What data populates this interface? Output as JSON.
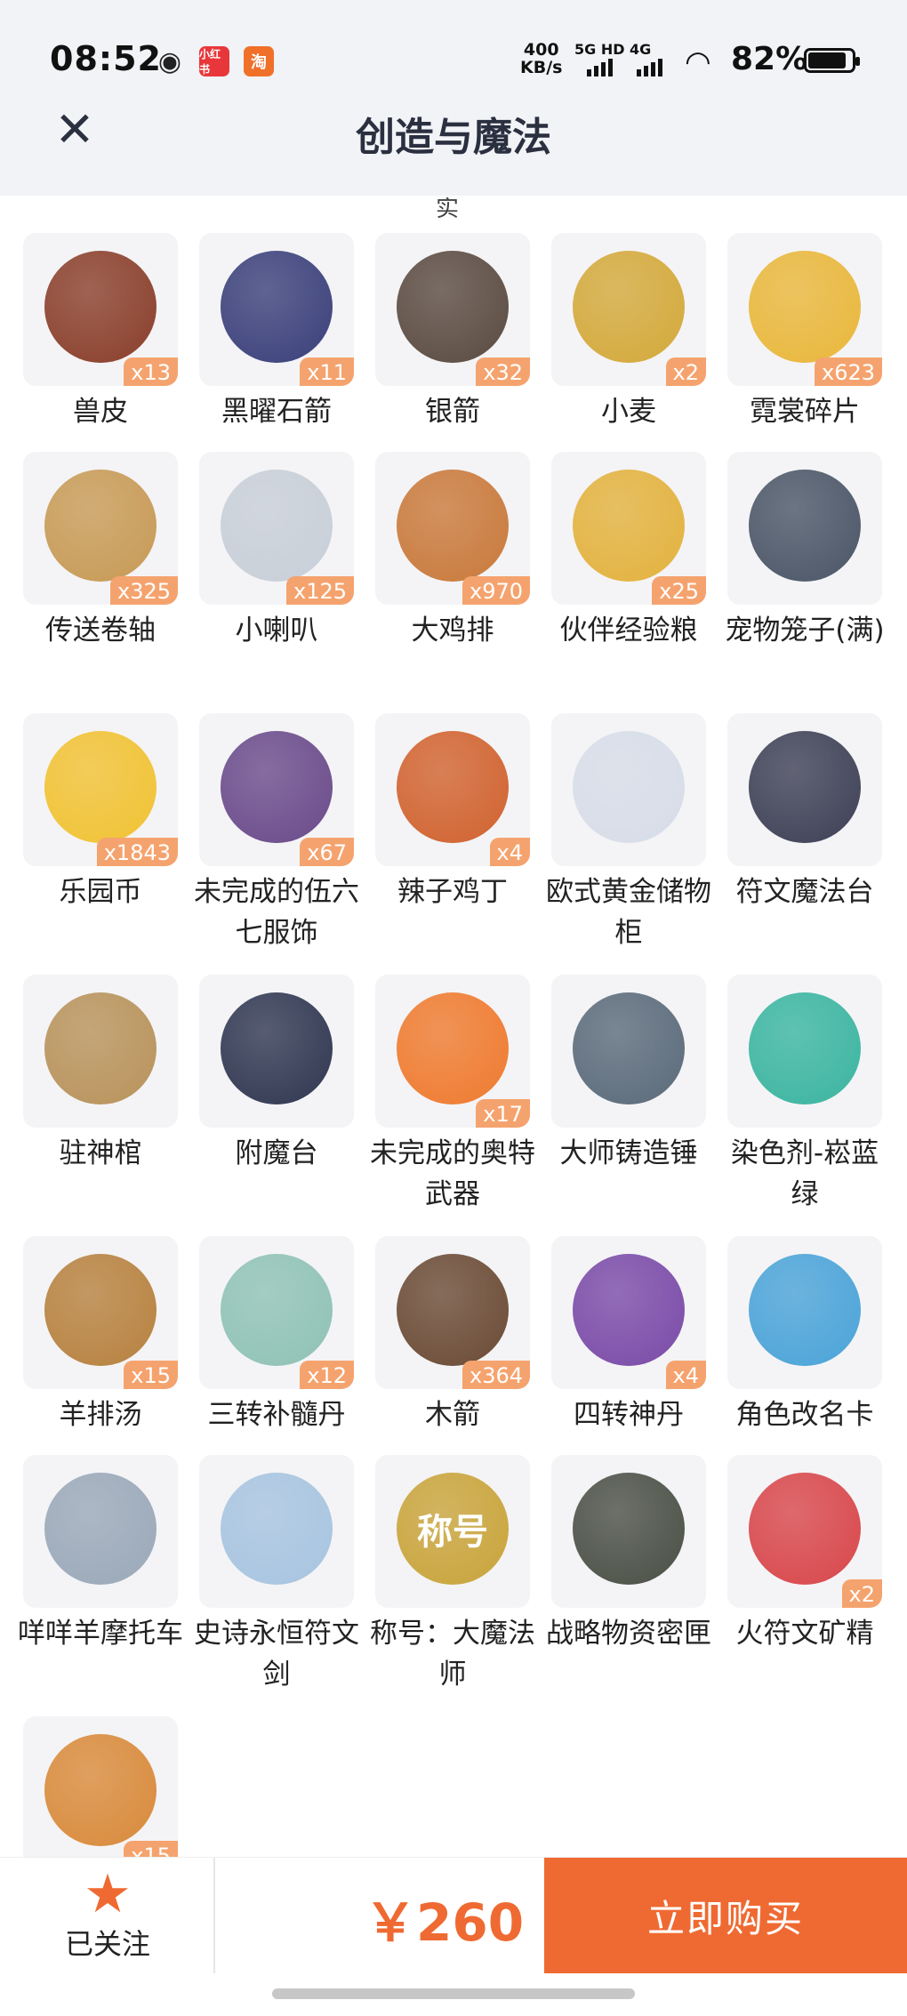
{
  "status_bar": {
    "time": "08:52",
    "net_speed_value": "400",
    "net_speed_unit": "KB/s",
    "net_label_1": "5G HD",
    "net_label_2": "4G",
    "battery": "82%",
    "app_icon_1": "小红书",
    "app_icon_2": "淘"
  },
  "header": {
    "title": "创造与魔法",
    "close_icon": "close-icon"
  },
  "grid_clip_text": "实",
  "items": [
    {
      "name": "兽皮",
      "count": "x13",
      "icon": "hide-icon",
      "color": "#8a3e2a"
    },
    {
      "name": "黑曜石箭",
      "count": "x11",
      "icon": "arrow-icon",
      "color": "#3a3f7a"
    },
    {
      "name": "银箭",
      "count": "x32",
      "icon": "arrow-icon",
      "color": "#5a4a40"
    },
    {
      "name": "小麦",
      "count": "x2",
      "icon": "wheat-icon",
      "color": "#d4a93a"
    },
    {
      "name": "霓裳碎片",
      "count": "x623",
      "icon": "shirt-icon",
      "color": "#e9b73a"
    },
    {
      "name": "传送卷轴",
      "count": "x325",
      "icon": "scroll-icon",
      "color": "#c79a55"
    },
    {
      "name": "小喇叭",
      "count": "x125",
      "icon": "megaphone-icon",
      "color": "#c8cfd8"
    },
    {
      "name": "大鸡排",
      "count": "x970",
      "icon": "chicken-icon",
      "color": "#c9793a"
    },
    {
      "name": "伙伴经验粮",
      "count": "x25",
      "icon": "bag-icon",
      "color": "#e3b23d"
    },
    {
      "name": "宠物笼子(满)",
      "count": "",
      "icon": "cage-icon",
      "color": "#4a5566"
    },
    {
      "name": "乐园币",
      "count": "x1843",
      "icon": "coin-icon",
      "color": "#f1c232"
    },
    {
      "name": "未完成的伍六七服饰",
      "count": "x67",
      "icon": "costume-icon",
      "color": "#6a4a8a"
    },
    {
      "name": "辣子鸡丁",
      "count": "x4",
      "icon": "dish-icon",
      "color": "#d1622e"
    },
    {
      "name": "欧式黄金储物柜",
      "count": "",
      "icon": "cabinet-icon",
      "color": "#d7dde8"
    },
    {
      "name": "符文魔法台",
      "count": "",
      "icon": "rune-altar-icon",
      "color": "#3d3f55"
    },
    {
      "name": "驻神棺",
      "count": "",
      "icon": "shrine-icon",
      "color": "#b8925a"
    },
    {
      "name": "附魔台",
      "count": "",
      "icon": "enchant-table-icon",
      "color": "#2f3650"
    },
    {
      "name": "未完成的奥特武器",
      "count": "x17",
      "icon": "weapon-icon",
      "color": "#ef7a2e"
    },
    {
      "name": "大师铸造锤",
      "count": "",
      "icon": "hammer-icon",
      "color": "#5a6a7a"
    },
    {
      "name": "染色剂-崧蓝绿",
      "count": "",
      "icon": "potion-icon",
      "color": "#3ab5a0"
    },
    {
      "name": "羊排汤",
      "count": "x15",
      "icon": "soup-icon",
      "color": "#b7813e"
    },
    {
      "name": "三转补髓丹",
      "count": "x12",
      "icon": "bottle-icon",
      "color": "#8fc2b5"
    },
    {
      "name": "木箭",
      "count": "x364",
      "icon": "arrow-icon",
      "color": "#6a4a34"
    },
    {
      "name": "四转神丹",
      "count": "x4",
      "icon": "pill-icon",
      "color": "#7a4aa8"
    },
    {
      "name": "角色改名卡",
      "count": "",
      "icon": "card-icon",
      "color": "#4aa3d8"
    },
    {
      "name": "咩咩羊摩托车",
      "count": "",
      "icon": "scooter-icon",
      "color": "#9aa8b8"
    },
    {
      "name": "史诗永恒符文剑",
      "count": "",
      "icon": "sword-icon",
      "color": "#a7c4e0"
    },
    {
      "name": "称号：大魔法师",
      "count": "",
      "icon": "title-badge-icon",
      "color": "#c9a43a",
      "badge_text": "称号"
    },
    {
      "name": "战略物资密匣",
      "count": "",
      "icon": "crate-icon",
      "color": "#4a4f45"
    },
    {
      "name": "火符文矿精",
      "count": "x2",
      "icon": "crystal-icon",
      "color": "#d8464a"
    },
    {
      "name": "",
      "count": "x15",
      "icon": "hotpot-icon",
      "color": "#d98a3a"
    }
  ],
  "bottom_bar": {
    "follow_label": "已关注",
    "star_icon": "star-icon",
    "price": "￥260",
    "buy_label": "立即购买"
  },
  "colors": {
    "accent": "#ef6a32",
    "count_badge": "#f5a36e",
    "header_bg": "#f1f3f6"
  }
}
